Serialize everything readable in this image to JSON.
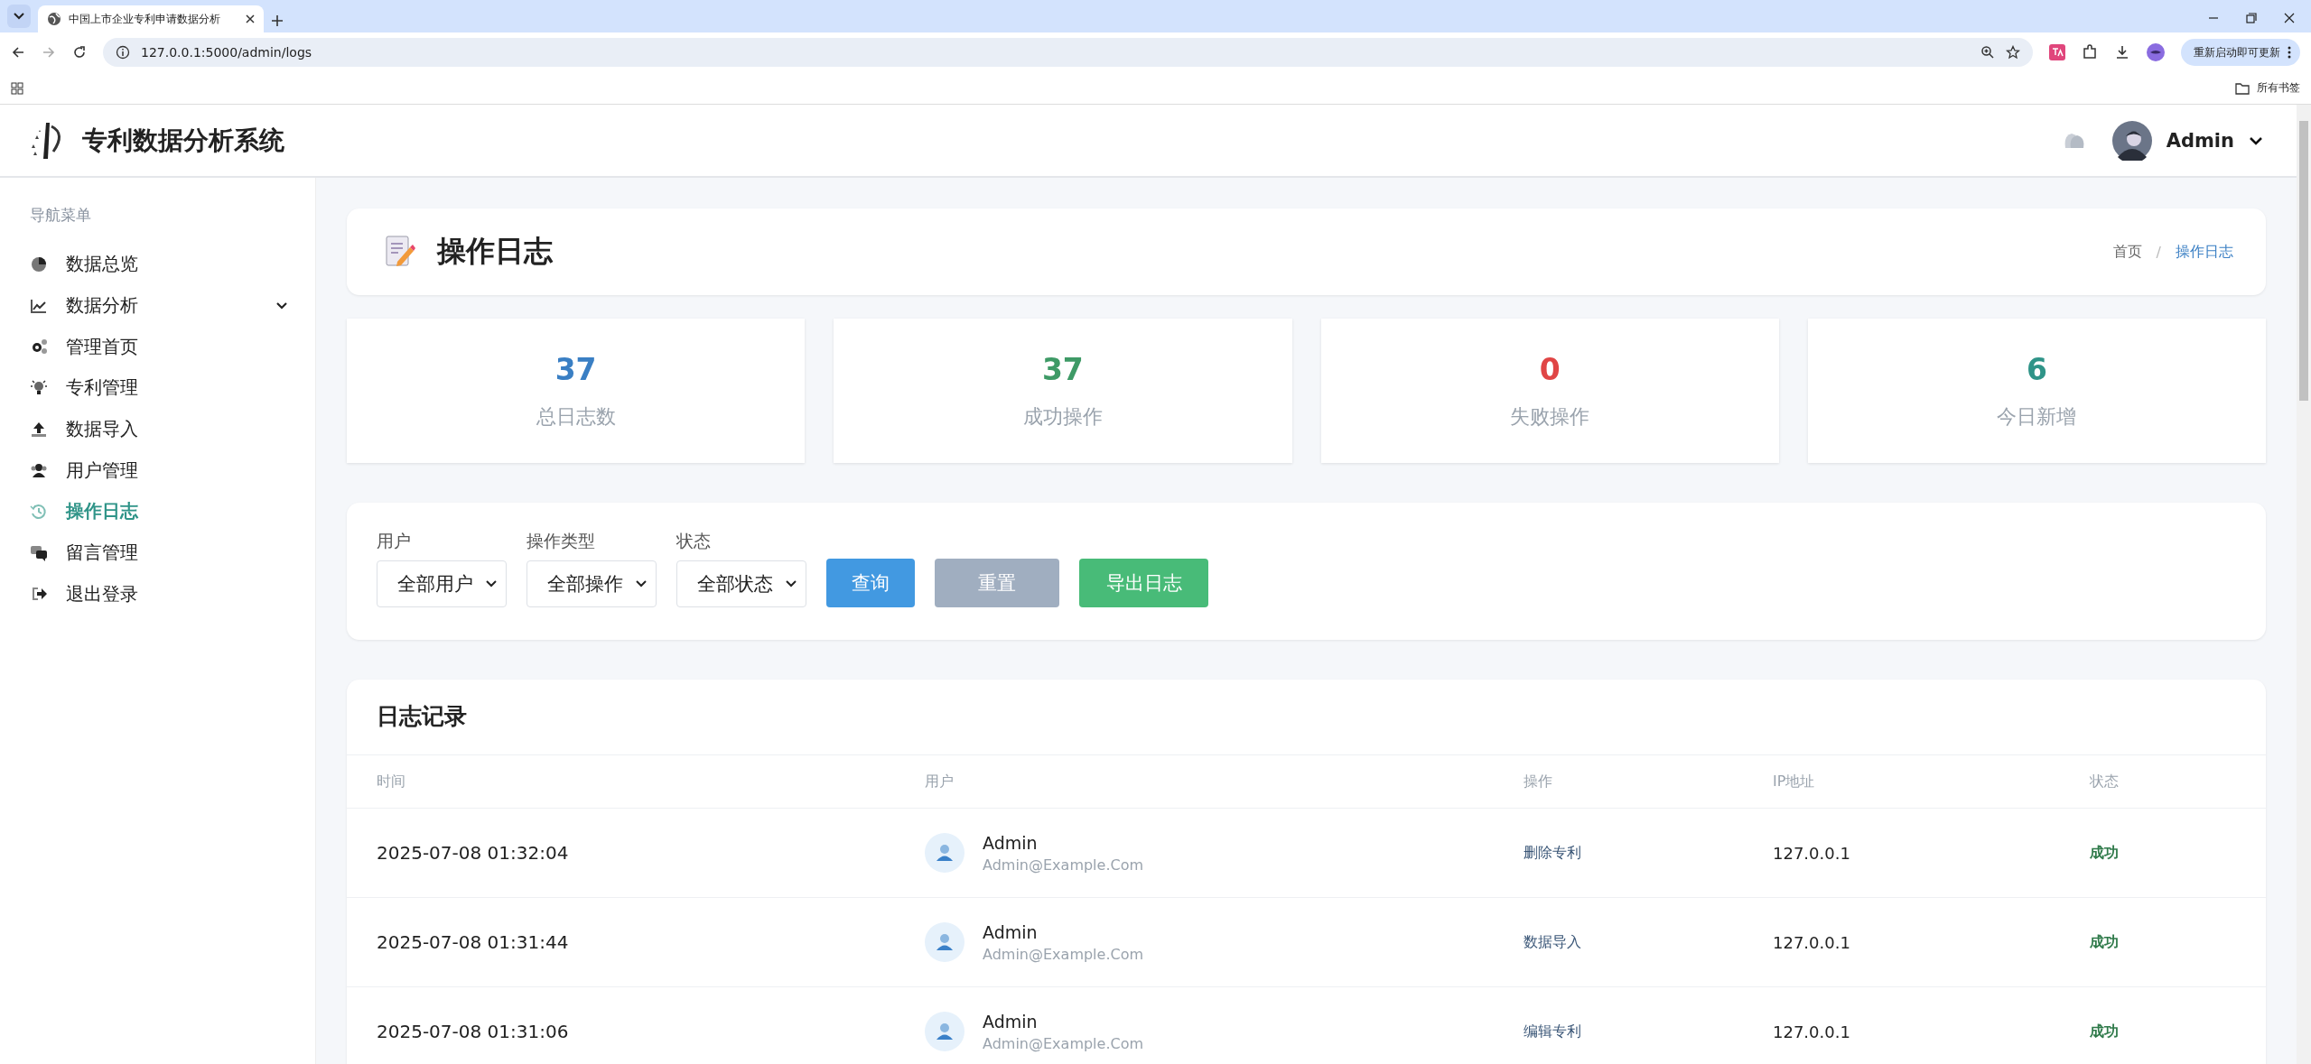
{
  "browser": {
    "tab_title": "中国上市企业专利申请数据分析",
    "url": "127.0.0.1:5000/admin/logs",
    "update_button": "重新启动即可更新",
    "bookmarks_label": "所有书签"
  },
  "header": {
    "brand": "专利数据分析系统",
    "user_name": "Admin"
  },
  "sidebar": {
    "section_label": "导航菜单",
    "items": [
      {
        "label": "数据总览",
        "kind": "link",
        "selected": false
      },
      {
        "label": "数据分析",
        "kind": "group",
        "selected": false
      },
      {
        "label": "管理首页",
        "kind": "link",
        "selected": false
      },
      {
        "label": "专利管理",
        "kind": "link",
        "selected": false
      },
      {
        "label": "数据导入",
        "kind": "link",
        "selected": false
      },
      {
        "label": "用户管理",
        "kind": "link",
        "selected": false
      },
      {
        "label": "操作日志",
        "kind": "link",
        "selected": true
      },
      {
        "label": "留言管理",
        "kind": "link",
        "selected": false
      },
      {
        "label": "退出登录",
        "kind": "link",
        "selected": false
      }
    ]
  },
  "page_header": {
    "title": "操作日志",
    "breadcrumb_separator": "/",
    "breadcrumb": [
      {
        "label": "首页",
        "selected": false
      },
      {
        "label": "操作日志",
        "selected": true
      }
    ]
  },
  "stats": [
    {
      "value": "37",
      "label": "总日志数",
      "color": "#3a7fc4"
    },
    {
      "value": "37",
      "label": "成功操作",
      "color": "#3e9a66"
    },
    {
      "value": "0",
      "label": "失败操作",
      "color": "#e04545"
    },
    {
      "value": "6",
      "label": "今日新增",
      "color": "#2f9488"
    }
  ],
  "filters": [
    {
      "label": "用户",
      "value": "全部用户"
    },
    {
      "label": "操作类型",
      "value": "全部操作"
    },
    {
      "label": "状态",
      "value": "全部状态"
    }
  ],
  "buttons": [
    {
      "label": "查询",
      "kind": "primary"
    },
    {
      "label": "重置",
      "kind": "secondary"
    },
    {
      "label": "导出日志",
      "kind": "success"
    }
  ],
  "table": {
    "title": "日志记录",
    "columns": [
      "时间",
      "用户",
      "操作",
      "IP地址",
      "状态"
    ],
    "rows": [
      {
        "time": "2025-07-08 01:32:04",
        "user_name": "Admin",
        "user_email": "Admin@Example.Com",
        "action": "删除专利",
        "ip": "127.0.0.1",
        "status": "成功"
      },
      {
        "time": "2025-07-08 01:31:44",
        "user_name": "Admin",
        "user_email": "Admin@Example.Com",
        "action": "数据导入",
        "ip": "127.0.0.1",
        "status": "成功"
      },
      {
        "time": "2025-07-08 01:31:06",
        "user_name": "Admin",
        "user_email": "Admin@Example.Com",
        "action": "编辑专利",
        "ip": "127.0.0.1",
        "status": "成功"
      }
    ]
  }
}
